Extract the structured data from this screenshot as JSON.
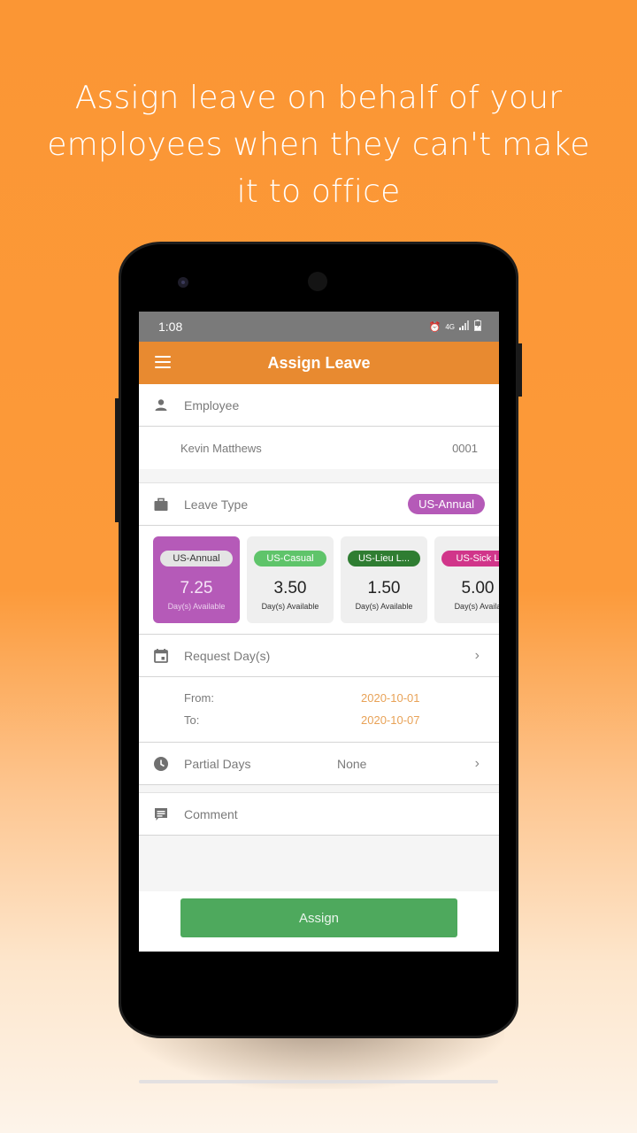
{
  "headline": "Assign leave on behalf of your employees when they can't make it to office",
  "status_bar": {
    "time": "1:08",
    "icons": [
      "alarm-icon",
      "4g-icon",
      "signal-icon",
      "battery-icon"
    ],
    "network_label": "4G"
  },
  "app_bar": {
    "title": "Assign Leave",
    "menu_icon": "hamburger-menu-icon"
  },
  "employee": {
    "section_label": "Employee",
    "name": "Kevin Matthews",
    "id": "0001"
  },
  "leave_type": {
    "section_label": "Leave Type",
    "selected": "US-Annual",
    "selected_color": "#b55ab8",
    "cards": [
      {
        "name": "US-Annual",
        "days": "7.25",
        "caption": "Day(s) Available",
        "color": "#e4e4e4",
        "tag_text_color": "#333333",
        "selected": true
      },
      {
        "name": "US-Casual",
        "days": "3.50",
        "caption": "Day(s) Available",
        "color": "#5fc46a",
        "tag_text_color": "#ffffff",
        "selected": false
      },
      {
        "name": "US-Lieu L...",
        "days": "1.50",
        "caption": "Day(s) Available",
        "color": "#2f7d32",
        "tag_text_color": "#ffffff",
        "selected": false
      },
      {
        "name": "US-Sick L",
        "days": "5.00",
        "caption": "Day(s) Availa",
        "color": "#d1358a",
        "tag_text_color": "#ffffff",
        "selected": false
      }
    ]
  },
  "request_days": {
    "label": "Request Day(s)",
    "from_label": "From:",
    "from_value": "2020-10-01",
    "to_label": "To:",
    "to_value": "2020-10-07"
  },
  "partial_days": {
    "label": "Partial Days",
    "value": "None"
  },
  "comment": {
    "label": "Comment"
  },
  "assign_button": "Assign",
  "colors": {
    "background_orange": "#fb9634",
    "app_bar": "#e88a30",
    "date_value": "#e8a257",
    "assign_button": "#4ea95d"
  }
}
